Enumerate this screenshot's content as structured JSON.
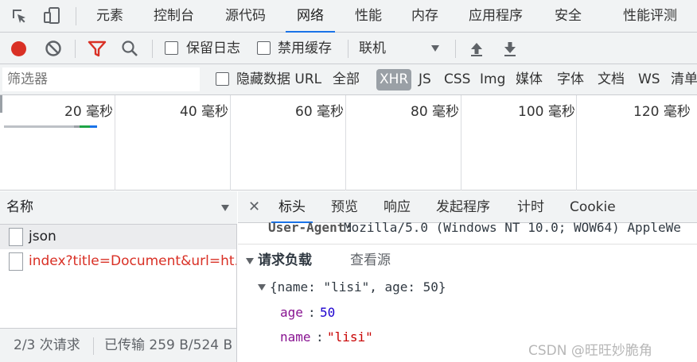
{
  "top_tabs": [
    "元素",
    "控制台",
    "源代码",
    "网络",
    "性能",
    "内存",
    "应用程序",
    "安全",
    "性能评测"
  ],
  "toolbar": {
    "preserve_log": "保留日志",
    "disable_cache": "禁用缓存",
    "throttle": "联机"
  },
  "filter": {
    "placeholder": "筛选器",
    "hide_data_urls": "隐藏数据 URL",
    "types": [
      "全部",
      "XHR",
      "JS",
      "CSS",
      "Img",
      "媒体",
      "字体",
      "文档",
      "WS",
      "清单"
    ]
  },
  "timeline": {
    "labels": [
      "20 毫秒",
      "40 毫秒",
      "60 毫秒",
      "80 毫秒",
      "100 毫秒",
      "120 毫秒"
    ]
  },
  "request_list": {
    "header": "名称",
    "rows": [
      {
        "name": "json",
        "status": "ok"
      },
      {
        "name": "index?title=Document&url=ht...",
        "status": "error"
      }
    ],
    "status_requests": "2/3 次请求",
    "status_transferred": "已传输 259 B/524 B"
  },
  "detail": {
    "tabs": [
      "标头",
      "预览",
      "响应",
      "发起程序",
      "计时",
      "Cookie"
    ],
    "user_agent_key": "User-Agent:",
    "user_agent_value": "Mozilla/5.0 (Windows NT 10.0; WOW64) AppleWe",
    "payload_title": "请求负载",
    "view_source": "查看源",
    "object_summary": "{name: \"lisi\", age: 50}",
    "fields": [
      {
        "key": "age",
        "value": "50"
      },
      {
        "key": "name",
        "value": "\"lisi\""
      }
    ]
  },
  "watermark": "CSDN @旺旺妙脆角",
  "colors": {
    "record_red": "#d93025",
    "accent_blue": "#1a73e8",
    "error_red": "#d93025",
    "json_key_purple": "#881391",
    "json_number_blue": "#1c00cf",
    "json_string_red": "#c80000"
  }
}
